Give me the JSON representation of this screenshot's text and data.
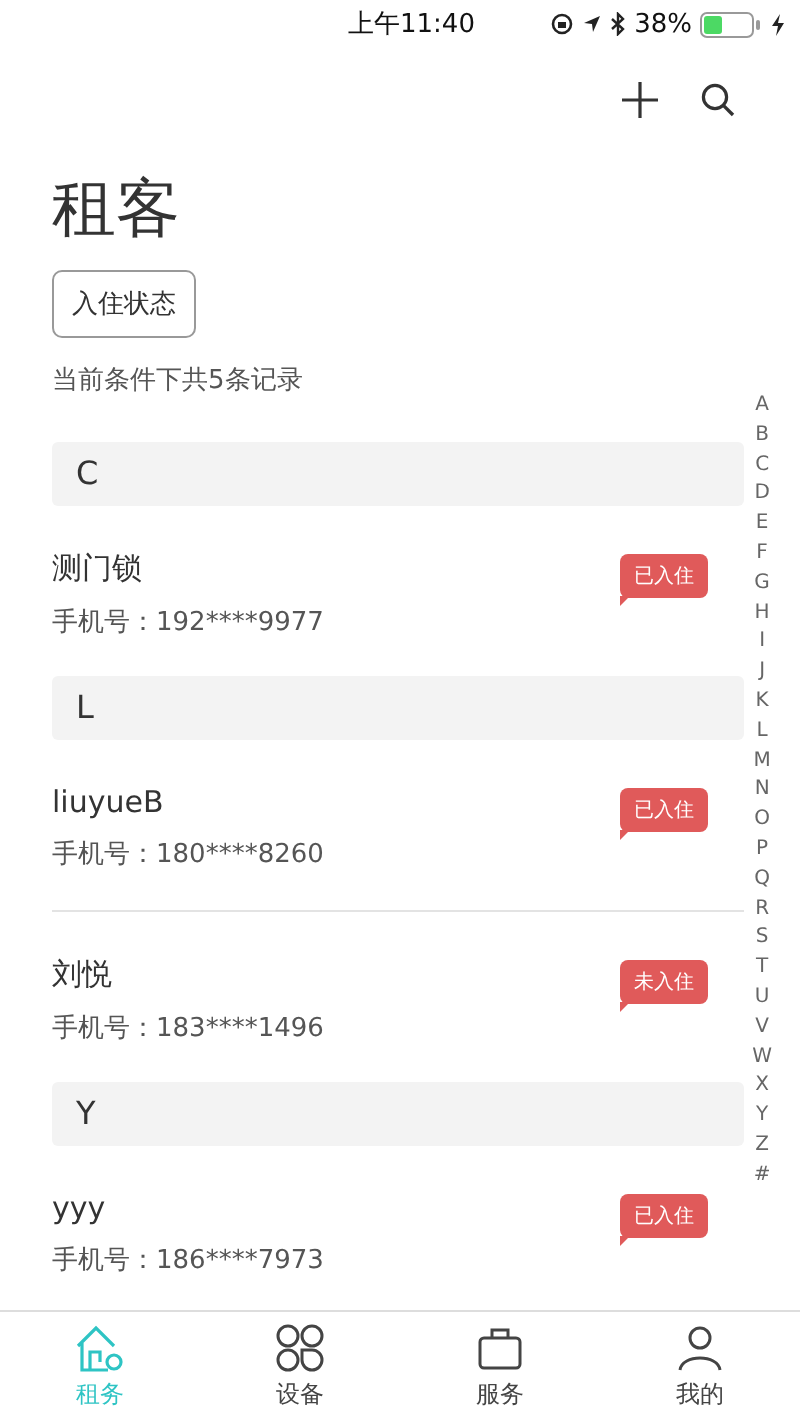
{
  "status_bar": {
    "time": "上午11:40",
    "battery": "38%"
  },
  "title": "租客",
  "filter_button": "入住状态",
  "record_count": "当前条件下共5条记录",
  "sections": [
    {
      "letter": "C",
      "tenants": [
        {
          "name": "测门锁",
          "phone": "手机号：192****9977",
          "status": "已入住"
        }
      ]
    },
    {
      "letter": "L",
      "tenants": [
        {
          "name": "liuyueB",
          "phone": "手机号：180****8260",
          "status": "已入住"
        },
        {
          "name": "刘悦",
          "phone": "手机号：183****1496",
          "status": "未入住"
        }
      ]
    },
    {
      "letter": "Y",
      "tenants": [
        {
          "name": "yyy",
          "phone": "手机号：186****7973",
          "status": "已入住"
        }
      ]
    }
  ],
  "index_letters": [
    "A",
    "B",
    "C",
    "D",
    "E",
    "F",
    "G",
    "H",
    "I",
    "J",
    "K",
    "L",
    "M",
    "N",
    "O",
    "P",
    "Q",
    "R",
    "S",
    "T",
    "U",
    "V",
    "W",
    "X",
    "Y",
    "Z",
    "#"
  ],
  "tabs": [
    {
      "label": "租务",
      "kind": "rental",
      "selected": true
    },
    {
      "label": "设备",
      "kind": "devices",
      "selected": false
    },
    {
      "label": "服务",
      "kind": "services",
      "selected": false
    },
    {
      "label": "我的",
      "kind": "me",
      "selected": false
    }
  ]
}
